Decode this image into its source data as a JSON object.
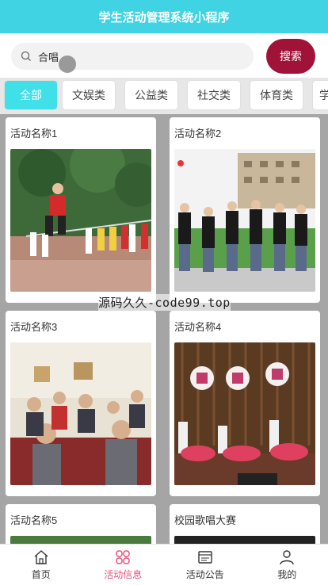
{
  "header": {
    "title": "学生活动管理系统小程序"
  },
  "search": {
    "value": "合唱",
    "button_label": "搜索"
  },
  "categories": [
    {
      "label": "全部",
      "active": true
    },
    {
      "label": "文娱类",
      "active": false
    },
    {
      "label": "公益类",
      "active": false
    },
    {
      "label": "社交类",
      "active": false
    },
    {
      "label": "体育类",
      "active": false
    },
    {
      "label": "学",
      "active": false
    }
  ],
  "activities": [
    {
      "title": "活动名称1"
    },
    {
      "title": "活动名称2"
    },
    {
      "title": "活动名称3"
    },
    {
      "title": "活动名称4"
    },
    {
      "title": "活动名称5"
    },
    {
      "title": "校园歌唱大赛"
    }
  ],
  "watermark": "源码久久-code99.top",
  "tabbar": [
    {
      "label": "首页",
      "icon": "home-icon",
      "active": false
    },
    {
      "label": "活动信息",
      "icon": "activity-info-icon",
      "active": true
    },
    {
      "label": "活动公告",
      "icon": "notice-icon",
      "active": false
    },
    {
      "label": "我的",
      "icon": "profile-icon",
      "active": false
    }
  ],
  "colors": {
    "header": "#3fd3e3",
    "search_button": "#a01238",
    "active_category": "#3fe0e8",
    "active_tab": "#e8517a"
  }
}
